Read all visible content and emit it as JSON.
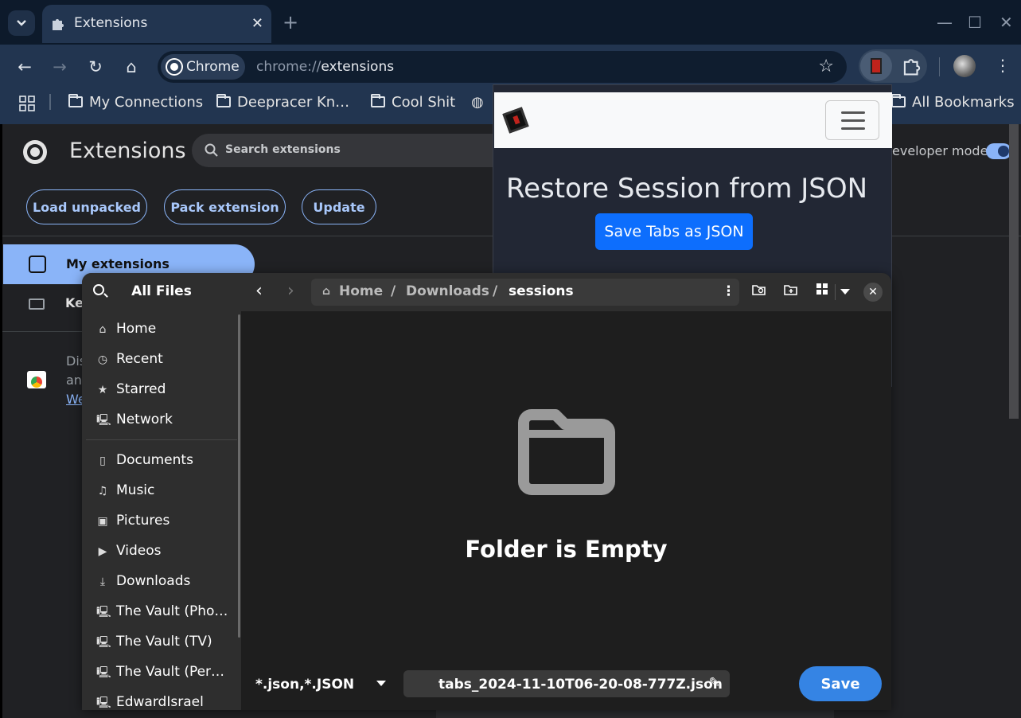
{
  "browser": {
    "tab_title": "Extensions",
    "tab_close": "✕",
    "new_tab": "+",
    "omnibox_chip": "Chrome",
    "url_scheme": "chrome://",
    "url_host": "extensions",
    "bookmarks": [
      "My Connections",
      "Deepracer Kn…",
      "Cool Shit",
      "All Bookmarks"
    ]
  },
  "extensions_page": {
    "title": "Extensions",
    "search_placeholder": "Search extensions",
    "developer_mode_label": "eveloper mode",
    "buttons": [
      "Load unpacked",
      "Pack extension",
      "Update"
    ],
    "sidebar_selected": "My extensions",
    "sidebar_second": "Ke",
    "discover_line1": "Dis",
    "discover_line2": "an",
    "discover_link": "We"
  },
  "popup": {
    "title": "Restore Session from JSON",
    "button": "Save Tabs as JSON"
  },
  "dialog": {
    "sidebar_title": "All Files",
    "places": [
      {
        "icon": "home-icon",
        "glyph": "⌂",
        "label": "Home"
      },
      {
        "icon": "recent-icon",
        "glyph": "◷",
        "label": "Recent"
      },
      {
        "icon": "starred-icon",
        "glyph": "★",
        "label": "Starred"
      },
      {
        "icon": "network-icon",
        "glyph": "🖳",
        "label": "Network"
      },
      {
        "icon": "documents-icon",
        "glyph": "▯",
        "label": "Documents"
      },
      {
        "icon": "music-icon",
        "glyph": "♫",
        "label": "Music"
      },
      {
        "icon": "pictures-icon",
        "glyph": "▣",
        "label": "Pictures"
      },
      {
        "icon": "videos-icon",
        "glyph": "▶",
        "label": "Videos"
      },
      {
        "icon": "downloads-icon",
        "glyph": "⤓",
        "label": "Downloads"
      },
      {
        "icon": "network-drive-icon",
        "glyph": "🖳",
        "label": "The Vault (Pho…"
      },
      {
        "icon": "network-drive-icon",
        "glyph": "🖳",
        "label": "The Vault (TV)"
      },
      {
        "icon": "network-drive-icon",
        "glyph": "🖳",
        "label": "The Vault (Per…"
      },
      {
        "icon": "network-drive-icon",
        "glyph": "🖳",
        "label": "EdwardIsrael"
      }
    ],
    "path": [
      "Home",
      "/",
      "Downloads",
      "/",
      "sessions"
    ],
    "empty_message": "Folder is Empty",
    "file_filter": "*.json,*.JSON",
    "file_name": "tabs_2024-11-10T06-20-08-777Z.json",
    "save_label": "Save",
    "close_glyph": "✕",
    "pencil_glyph": "✎"
  },
  "colors": {
    "accent_blue": "#3584e4",
    "bootstrap_primary": "#0d6efd",
    "chrome_accent": "#8ab4f8"
  }
}
